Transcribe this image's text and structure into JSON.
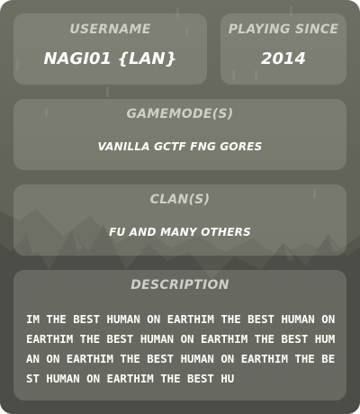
{
  "username": {
    "label": "USERNAME",
    "value": "NAGI01 {LAN}"
  },
  "playing_since": {
    "label": "PLAYING SINCE",
    "value": "2014"
  },
  "gamemodes": {
    "label": "GAMEMODE(S)",
    "value": "VANILLA GCTF FNG GORES"
  },
  "clans": {
    "label": "CLAN(S)",
    "value": "FU AND MANY OTHERS"
  },
  "description": {
    "label": "DESCRIPTION",
    "text": "IM THE BEST HUMAN ON EARTHIM THE BEST HUMAN ON EARTHIM THE BEST HUMAN ON EARTHIM THE BEST HUMAN ON EARTHIM THE BEST HUMAN ON EARTHIM THE BEST HUMAN ON EARTHIM THE BEST HU"
  },
  "colors": {
    "background": "#626458",
    "panel": "#8a8c80",
    "label": "#cfd0c6",
    "value": "#ffffff",
    "mountains": "#4a4c45"
  }
}
